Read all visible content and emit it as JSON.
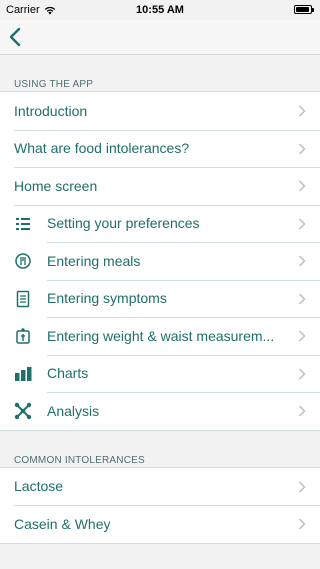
{
  "status": {
    "carrier": "Carrier",
    "time": "10:55 AM"
  },
  "sections": [
    {
      "header": "USING THE APP",
      "rows": [
        {
          "label": "Introduction"
        },
        {
          "label": "What are food intolerances?"
        },
        {
          "label": "Home screen"
        },
        {
          "label": "Setting your preferences",
          "icon": "preferences-icon"
        },
        {
          "label": "Entering meals",
          "icon": "meal-icon"
        },
        {
          "label": "Entering symptoms",
          "icon": "symptoms-icon"
        },
        {
          "label": "Entering weight & waist measurem...",
          "icon": "weight-icon"
        },
        {
          "label": "Charts",
          "icon": "chart-icon"
        },
        {
          "label": "Analysis",
          "icon": "analysis-icon"
        }
      ]
    },
    {
      "header": "COMMON INTOLERANCES",
      "rows": [
        {
          "label": "Lactose"
        },
        {
          "label": "Casein & Whey"
        }
      ]
    }
  ],
  "colors": {
    "accent": "#1f6f6a",
    "separator": "#cfe0dd",
    "background": "#f2f2f2"
  }
}
